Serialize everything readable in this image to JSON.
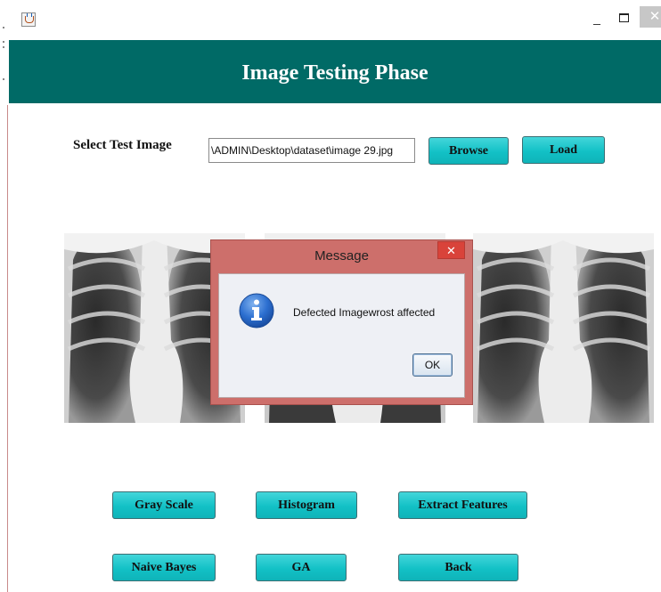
{
  "window": {
    "icon": "java-cup-icon",
    "minimize": "_",
    "maximize": "▢",
    "close": "✕"
  },
  "header": {
    "title": "Image Testing Phase",
    "bg_color": "#006a66"
  },
  "select": {
    "label": "Select Test Image",
    "path_value": "\\ADMIN\\Desktop\\dataset\\image 29.jpg",
    "browse_label": "Browse",
    "load_label": "Load"
  },
  "images": [
    {
      "name": "original-xray"
    },
    {
      "name": "processed-xray"
    },
    {
      "name": "result-xray"
    }
  ],
  "dialog": {
    "title": "Message",
    "close": "✕",
    "icon": "info-icon",
    "message": "Defected Imagewrost affected",
    "ok_label": "OK"
  },
  "actions": {
    "gray_scale": "Gray Scale",
    "histogram": "Histogram",
    "extract_features": "Extract Features",
    "naive_bayes": "Naive Bayes",
    "ga": "GA",
    "back": "Back"
  },
  "colors": {
    "button": "#12c1c6",
    "dialog_frame": "#cd6f6b"
  }
}
